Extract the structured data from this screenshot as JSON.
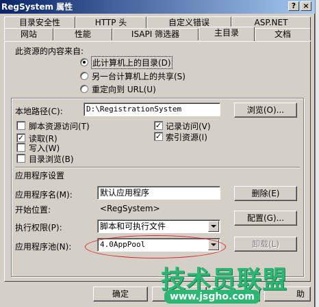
{
  "window": {
    "title": "RegSystem 属性",
    "help_btn": "?",
    "close_btn": "×"
  },
  "tabs_row1": [
    "目录安全性",
    "HTTP 头",
    "自定义错误",
    "ASP.NET"
  ],
  "tabs_row2": [
    "网站",
    "性能",
    "ISAPI 筛选器",
    "主目录",
    "文档"
  ],
  "content_source": {
    "label": "此资源的内容来自:",
    "options": [
      "此计算机上的目录(D)",
      "另一台计算机上的共享(S)",
      "重定向到 URL(U)"
    ]
  },
  "local_path": {
    "label": "本地路径(C):",
    "value": "D:\\RegistrationSystem",
    "browse": "浏览(O)..."
  },
  "checks": {
    "script_access": "脚本资源访问(T)",
    "read": "读取(R)",
    "write": "写入(W)",
    "dir_browse": "目录浏览(B)",
    "log_visits": "记录访问(V)",
    "index_resource": "索引资源(I)"
  },
  "app_settings": {
    "title": "应用程序设置",
    "name_label": "应用程序名(M):",
    "name_value": "默认应用程序",
    "remove": "删除(E)",
    "start_label": "开始位置:",
    "start_value": "<RegSystem>",
    "config": "配置(G)...",
    "exec_label": "执行权限(P):",
    "exec_value": "脚本和可执行文件",
    "pool_label": "应用程序池(N):",
    "pool_value": "4.0AppPool",
    "unload": "卸载(L)"
  },
  "footer": {
    "ok": "确定",
    "help_partial": "助"
  },
  "watermark": {
    "cn": "技术员联盟",
    "url": "www.jsgho.com"
  }
}
